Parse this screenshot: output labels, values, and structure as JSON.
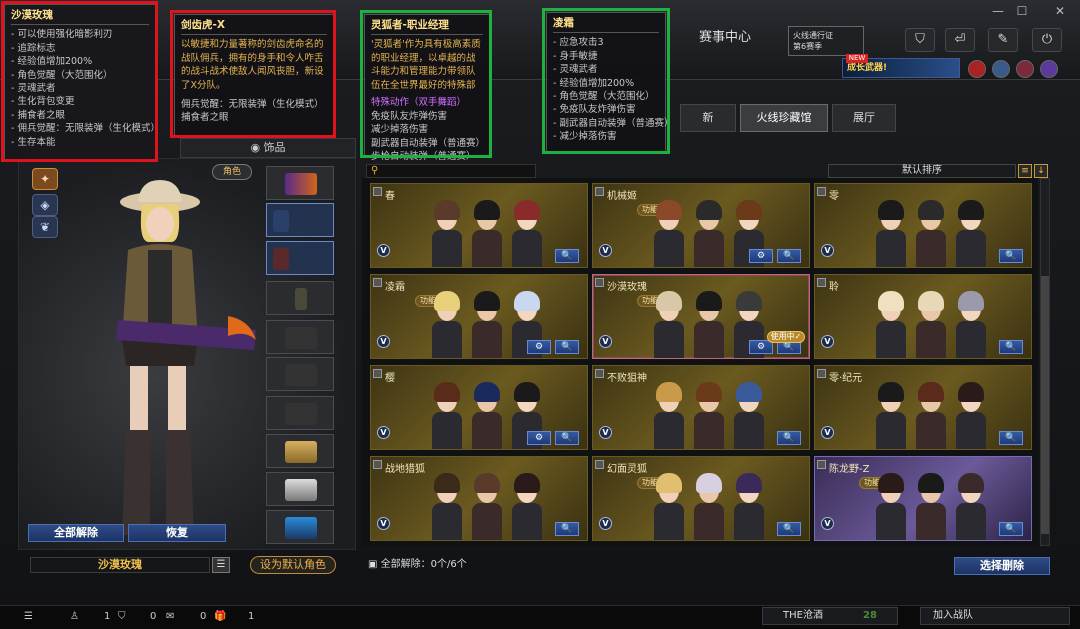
{
  "window": {
    "minimize": "—",
    "maximize": "☐",
    "close": "✕"
  },
  "top": {
    "event_center": "赛事中心",
    "battlepass": "火线通行证\n第6赛季",
    "promo_new": "NEW",
    "promo": "成长武器!",
    "icons": [
      "shield-icon",
      "return-icon",
      "wrench-icon",
      "power-icon"
    ]
  },
  "tabs": [
    {
      "label": "新",
      "active": false
    },
    {
      "label": "火线珍藏馆",
      "active": true
    },
    {
      "label": "展厅",
      "active": false
    }
  ],
  "left": {
    "accessory_header": "饰品",
    "role_tag": "角色",
    "unload_all": "全部解除",
    "restore": "恢复",
    "character_name": "沙漠玫瑰",
    "set_default": "设为默认角色"
  },
  "grid": {
    "sort_label": "默认排序",
    "search_icon": "search-icon",
    "cards": [
      {
        "name": "春",
        "tag": "",
        "selected": false,
        "in_use": false,
        "gear": false,
        "style": "gold"
      },
      {
        "name": "机械姬",
        "tag": "功能型",
        "selected": false,
        "in_use": false,
        "gear": true,
        "style": "gold"
      },
      {
        "name": "零",
        "tag": "",
        "selected": false,
        "in_use": false,
        "gear": false,
        "style": "gold"
      },
      {
        "name": "凌霜",
        "tag": "功能型",
        "selected": false,
        "in_use": false,
        "gear": true,
        "style": "gold"
      },
      {
        "name": "沙漠玫瑰",
        "tag": "功能型",
        "selected": true,
        "in_use": true,
        "gear": true,
        "style": "gold"
      },
      {
        "name": "聆",
        "tag": "",
        "selected": false,
        "in_use": false,
        "gear": false,
        "style": "gold"
      },
      {
        "name": "樱",
        "tag": "",
        "selected": false,
        "in_use": false,
        "gear": true,
        "style": "gold"
      },
      {
        "name": "不败狙神",
        "tag": "",
        "selected": false,
        "in_use": false,
        "gear": false,
        "style": "gold"
      },
      {
        "name": "零·纪元",
        "tag": "",
        "selected": false,
        "in_use": false,
        "gear": false,
        "style": "gold"
      },
      {
        "name": "战地猎狐",
        "tag": "",
        "selected": false,
        "in_use": false,
        "gear": false,
        "style": "gold"
      },
      {
        "name": "幻面灵狐",
        "tag": "功能型",
        "selected": false,
        "in_use": false,
        "gear": false,
        "style": "gold"
      },
      {
        "name": "陈龙野-Z",
        "tag": "功能型",
        "selected": false,
        "in_use": false,
        "gear": false,
        "style": "purple"
      }
    ],
    "in_use_label": "使用中✓",
    "unload_count": "全部解除：0个/6个",
    "select_unload": "选择删除"
  },
  "status": {
    "players": "1",
    "friends": "0",
    "messages": "0",
    "gifts": "1",
    "jiu": "THE沧酒",
    "jiu_num": "28",
    "join": "加入战队"
  },
  "tooltips": {
    "desert_rose": {
      "title": "沙漠玫瑰",
      "rows": [
        "- 可以使用强化暗影利刃",
        "- 追踪标志",
        "- 经验值增加200%",
        "- 角色觉醒（大范围化）",
        "- 灵魂武者",
        "- 生化背包变更",
        "- 捕食者之眼",
        "- 佣兵觉醒：无限装弹（生化模式）",
        "- 生存本能"
      ]
    },
    "sabertooth": {
      "title": "剑齿虎-X",
      "desc": "以敏捷和力量著称的剑齿虎命名的战队佣兵，拥有的身手和令人咋舌的战斗战术使敌人闻风丧胆，新设了X分队。",
      "rows": [
        "佣兵觉醒：无限装弹（生化模式）",
        "捕食者之眼"
      ]
    },
    "spirit_fox": {
      "title": "灵狐者-职业经理",
      "desc": "'灵狐者'作为具有极高素质的职业经理，以卓越的战斗能力和管理能力带领队伍在全世界最好的特殊部队的队员。",
      "rows": [
        "特殊动作（双手舞蹈）",
        "免疫队友炸弹伤害",
        "减少掉落伤害",
        "副武器自动装弹（普通赛）",
        "步枪自动装弹（普通赛）"
      ]
    },
    "lingshuang": {
      "title": "凌霜",
      "rows": [
        "- 应急攻击3",
        "- 身手敏捷",
        "- 灵魂武者",
        "- 经验值增加200%",
        "- 角色觉醒（大范围化）",
        "- 免疫队友炸弹伤害",
        "- 副武器自动装弹（普通赛）",
        "- 减少掉落伤害"
      ]
    }
  }
}
